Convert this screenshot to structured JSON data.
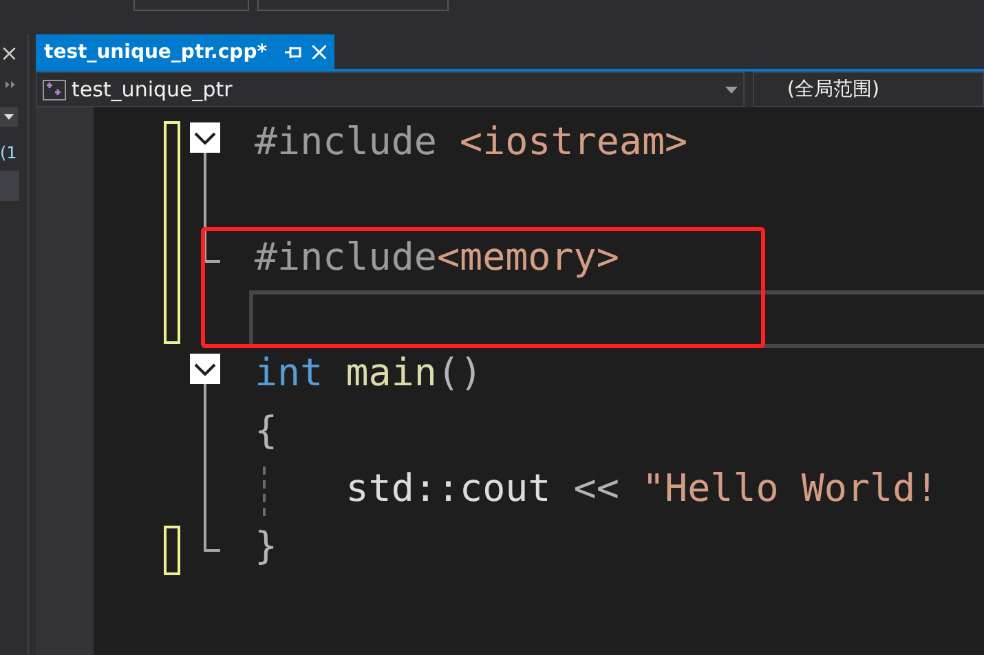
{
  "side_panel": {
    "close": "×",
    "label": "(1"
  },
  "tab": {
    "title": "test_unique_ptr.cpp*",
    "selected": true
  },
  "nav_bar": {
    "project": "test_unique_ptr",
    "scope": "(全局范围)"
  },
  "lines": [
    {
      "kind": "fold-start",
      "changed": true,
      "current": false,
      "annotated": false,
      "indent_guide": false,
      "tokens": [
        {
          "kind": "preproc",
          "text": "#include "
        },
        {
          "kind": "path",
          "text": "<iostream>"
        }
      ]
    },
    {
      "kind": "fold-mid",
      "changed": true,
      "current": false,
      "annotated": false,
      "indent_guide": false
    },
    {
      "kind": "fold-end",
      "changed": true,
      "current": false,
      "annotated": true,
      "indent_guide": false,
      "tokens": [
        {
          "kind": "preproc",
          "text": "#include"
        },
        {
          "kind": "path",
          "text": "<memory>"
        }
      ]
    },
    {
      "kind": "plain",
      "changed": true,
      "current": true,
      "annotated": true,
      "indent_guide": false
    },
    {
      "kind": "fold-start",
      "changed": false,
      "current": false,
      "annotated": false,
      "indent_guide": false,
      "tokens": [
        {
          "kind": "keyword",
          "text": "int "
        },
        {
          "kind": "function",
          "text": "main"
        },
        {
          "kind": "punct",
          "text": "()"
        }
      ]
    },
    {
      "kind": "fold-mid",
      "changed": false,
      "current": false,
      "annotated": false,
      "indent_guide": false,
      "tokens": [
        {
          "kind": "punct",
          "text": "{"
        }
      ]
    },
    {
      "kind": "fold-mid",
      "changed": false,
      "current": false,
      "annotated": false,
      "indent_guide": true,
      "tokens": [
        {
          "kind": "plain",
          "text": "    std::cout "
        },
        {
          "kind": "punct",
          "text": "<< "
        },
        {
          "kind": "string",
          "text": "\"Hello World!"
        }
      ]
    },
    {
      "kind": "fold-end",
      "changed": true,
      "current": false,
      "annotated": false,
      "indent_guide": false,
      "tokens": [
        {
          "kind": "punct",
          "text": "}"
        }
      ]
    }
  ]
}
